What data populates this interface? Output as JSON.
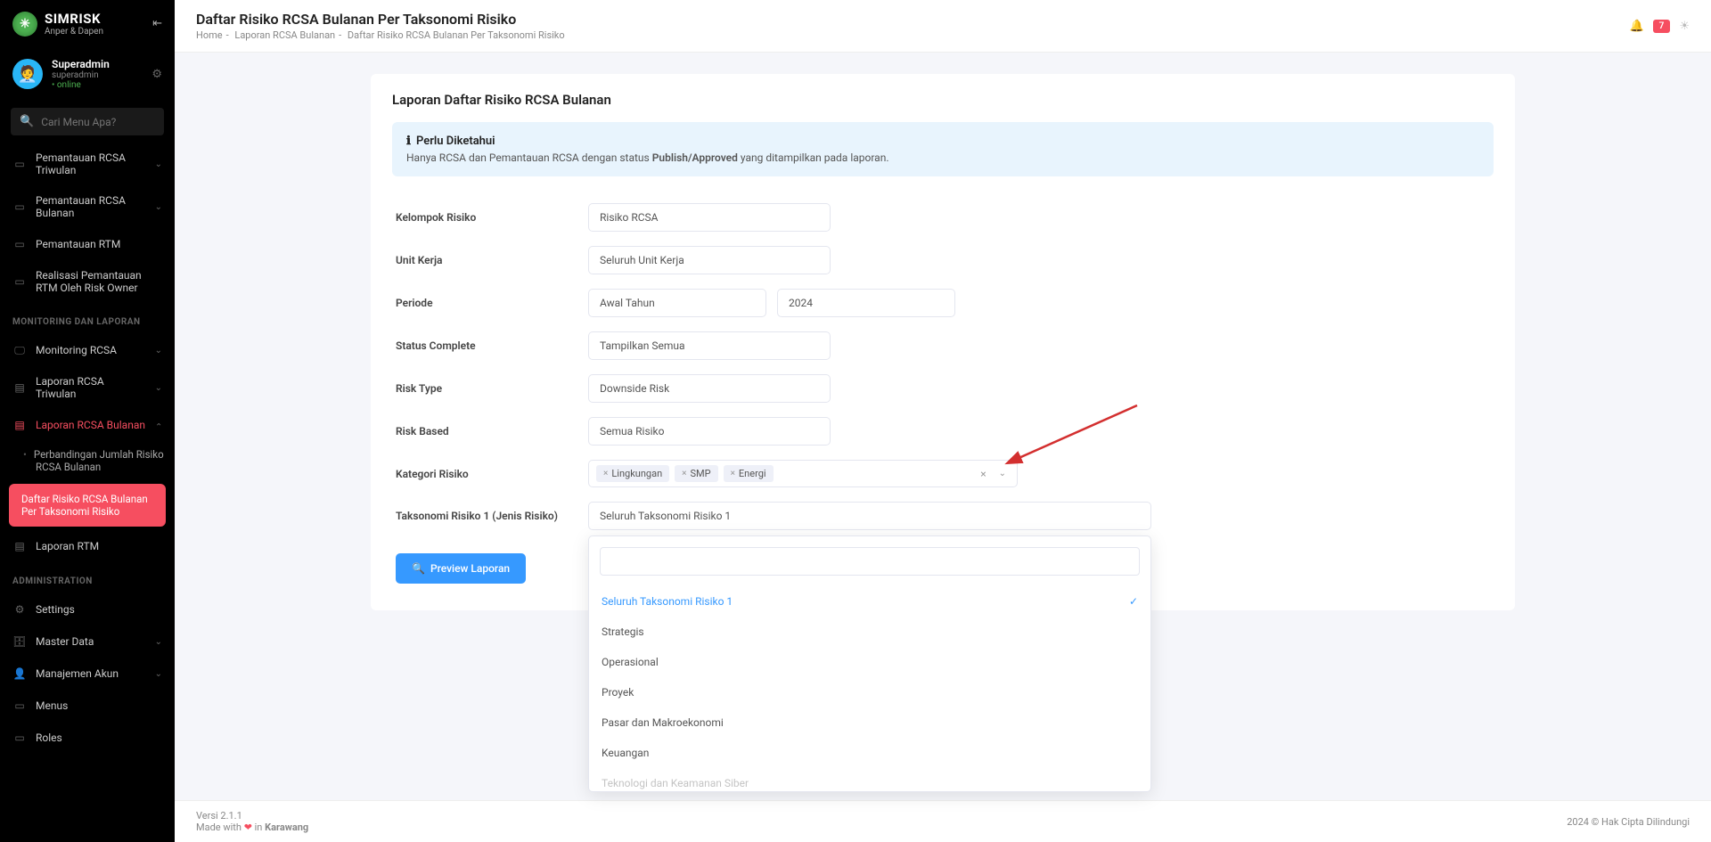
{
  "brand": {
    "title": "SIMRISK",
    "subtitle": "Anper & Dapen"
  },
  "user": {
    "name": "Superadmin",
    "login": "superadmin",
    "status": "• online"
  },
  "search": {
    "placeholder": "Cari Menu Apa?"
  },
  "nav": {
    "pemantauan_triwulan": "Pemantauan RCSA Triwulan",
    "pemantauan_bulanan": "Pemantauan RCSA Bulanan",
    "pemantauan_rtm": "Pemantauan RTM",
    "realisasi_rtm": "Realisasi Pemantauan RTM Oleh Risk Owner",
    "section_monitoring": "MONITORING DAN LAPORAN",
    "monitoring_rcsa": "Monitoring RCSA",
    "laporan_triwulan": "Laporan RCSA Triwulan",
    "laporan_bulanan": "Laporan RCSA Bulanan",
    "sub_perbandingan": "Perbandingan Jumlah Risiko RCSA Bulanan",
    "sub_daftar": "Daftar Risiko RCSA Bulanan Per Taksonomi Risiko",
    "laporan_rtm": "Laporan RTM",
    "section_admin": "ADMINISTRATION",
    "settings": "Settings",
    "master_data": "Master Data",
    "manajemen_akun": "Manajemen Akun",
    "menus": "Menus",
    "roles": "Roles"
  },
  "header": {
    "title": "Daftar Risiko RCSA Bulanan Per Taksonomi Risiko",
    "crumb_home": "Home",
    "crumb_laporan": "Laporan RCSA Bulanan",
    "crumb_current": "Daftar Risiko RCSA Bulanan Per Taksonomi Risiko",
    "badge": "7"
  },
  "card": {
    "title": "Laporan Daftar Risiko RCSA Bulanan",
    "info_title": "Perlu Diketahui",
    "info_text_pre": "Hanya RCSA dan Pemantauan RCSA dengan status ",
    "info_text_bold": "Publish/Approved",
    "info_text_post": " yang ditampilkan pada laporan."
  },
  "form": {
    "kelompok_label": "Kelompok Risiko",
    "kelompok_value": "Risiko RCSA",
    "unit_label": "Unit Kerja",
    "unit_value": "Seluruh Unit Kerja",
    "periode_label": "Periode",
    "periode_value1": "Awal Tahun",
    "periode_value2": "2024",
    "status_label": "Status Complete",
    "status_value": "Tampilkan Semua",
    "risktype_label": "Risk Type",
    "risktype_value": "Downside Risk",
    "riskbased_label": "Risk Based",
    "riskbased_value": "Semua Risiko",
    "kategori_label": "Kategori Risiko",
    "kategori_tags": [
      "Lingkungan",
      "SMP",
      "Energi"
    ],
    "taksonomi_label": "Taksonomi Risiko 1 (Jenis Risiko)",
    "taksonomi_value": "Seluruh Taksonomi Risiko 1",
    "dropdown_options": [
      "Seluruh Taksonomi Risiko 1",
      "Strategis",
      "Operasional",
      "Proyek",
      "Pasar dan Makroekonomi",
      "Keuangan",
      "Teknologi dan Keamanan Siber"
    ],
    "button": "Preview Laporan"
  },
  "footer": {
    "version": "Versi 2.1.1",
    "made_pre": "Made with ",
    "made_post": " in ",
    "location": "Karawang",
    "copyright": "2024 © Hak Cipta Dilindungi"
  }
}
